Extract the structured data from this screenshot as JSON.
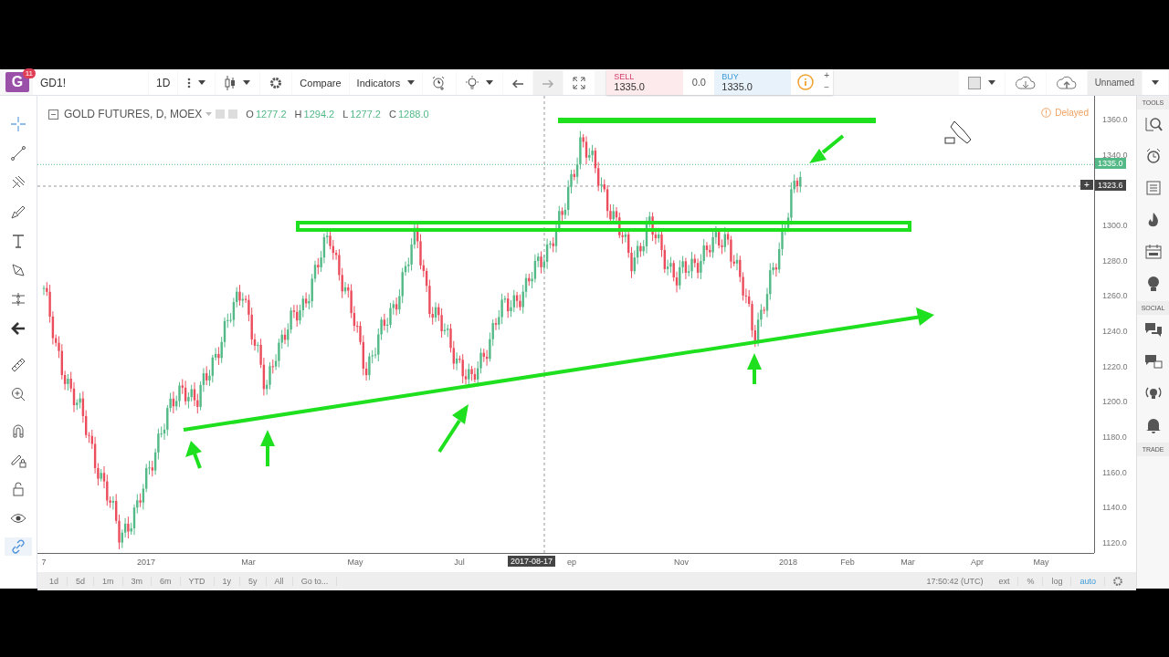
{
  "header": {
    "avatar_letter": "G",
    "badge": "11",
    "symbol": "GD1!",
    "interval": "1D",
    "compare": "Compare",
    "indicators": "Indicators"
  },
  "trade": {
    "sell_label": "SELL",
    "sell_price": "1335.0",
    "spread": "0.0",
    "buy_label": "BUY",
    "buy_price": "1335.0",
    "plus": "+",
    "minus": "−"
  },
  "layout_name": "Unnamed",
  "legend": {
    "title": "GOLD FUTURES, D, MOEX",
    "ohlc": [
      {
        "key": "O",
        "value": "1277.2"
      },
      {
        "key": "H",
        "value": "1294.2"
      },
      {
        "key": "L",
        "value": "1277.2"
      },
      {
        "key": "C",
        "value": "1288.0"
      }
    ]
  },
  "status": "Delayed",
  "price_axis": {
    "labels": [
      "1360.0",
      "1340.0",
      "1300.0",
      "1280.0",
      "1260.0",
      "1240.0",
      "1220.0",
      "1200.0",
      "1180.0",
      "1160.0",
      "1140.0",
      "1120.0"
    ],
    "last_price": "1335.0",
    "crosshair_price": "1323.6",
    "crosshair_plus": "+"
  },
  "time_axis": {
    "labels": [
      "7",
      "2017",
      "Mar",
      "May",
      "Jul",
      "ep",
      "Nov",
      "2018",
      "Feb",
      "Mar",
      "Apr",
      "May"
    ],
    "crosshair_date": "2017-08-17"
  },
  "ranges": [
    "1d",
    "5d",
    "1m",
    "3m",
    "6m",
    "YTD",
    "1y",
    "5y",
    "All",
    "Go to..."
  ],
  "bottom_bar": {
    "clock": "17:50:42 (UTC)",
    "options": [
      {
        "label": "ext",
        "selected": false
      },
      {
        "label": "%",
        "selected": false
      },
      {
        "label": "log",
        "selected": false
      },
      {
        "label": "auto",
        "selected": true
      }
    ]
  },
  "drawing_toolbar": {
    "link_mode_on": true
  },
  "sidebar": {
    "sections": [
      "TOOLS",
      "SOCIAL",
      "TRADE"
    ]
  }
}
